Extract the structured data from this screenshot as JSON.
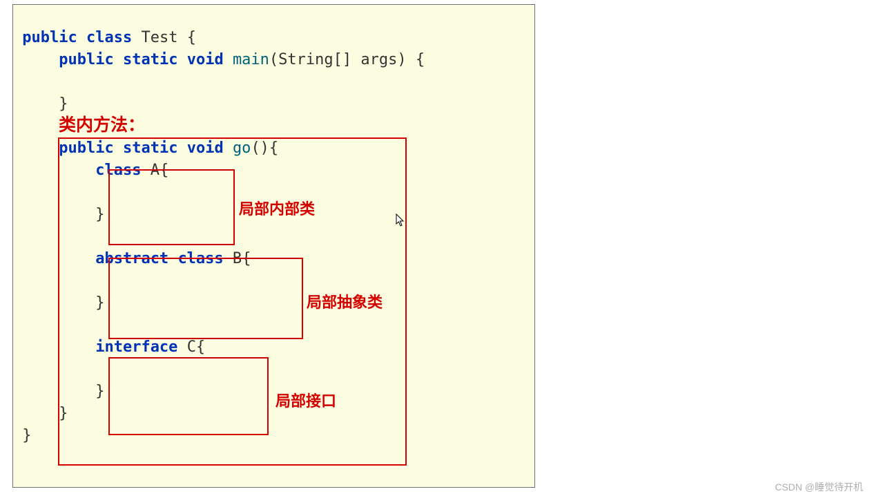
{
  "code": {
    "l1_kw1": "public",
    "l1_kw2": "class",
    "l1_ident": "Test",
    "l1_brace": "{",
    "l2_kw1": "public",
    "l2_kw2": "static",
    "l2_kw3": "void",
    "l2_method": "main",
    "l2_args_open": "(",
    "l2_type": "String",
    "l2_args_rest": "[] args) {",
    "l4_close": "}",
    "go_kw1": "public",
    "go_kw2": "static",
    "go_kw3": "void",
    "go_method": "go",
    "go_paren": "(){",
    "a_kw": "class",
    "a_ident": "A{",
    "a_close": "}",
    "b_kw1": "abstract",
    "b_kw2": "class",
    "b_ident": "B{",
    "b_close": "}",
    "c_kw": "interface",
    "c_ident": "C{",
    "c_close": "}",
    "go_close": "}",
    "outer_close": "}"
  },
  "annotations": {
    "title": "类内方法：",
    "local_inner_class": "局部内部类",
    "local_abstract_class": "局部抽象类",
    "local_interface": "局部接口"
  },
  "watermark": "CSDN @睡觉待开机"
}
